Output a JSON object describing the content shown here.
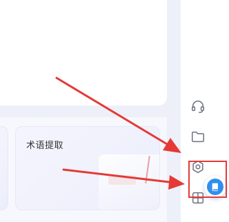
{
  "tools": {
    "term_extraction": {
      "title": "术语提取"
    }
  },
  "sidebar": {
    "icons": [
      "headset-icon",
      "folder-icon",
      "settings-icon",
      "layout-icon"
    ],
    "book_button_icon": "book-icon"
  },
  "colors": {
    "accent": "#2f8ff0",
    "annotation": "#e53935",
    "background": "#eef0f9"
  }
}
